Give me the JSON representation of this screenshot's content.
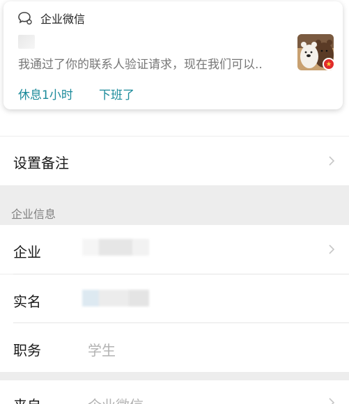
{
  "notification": {
    "app_name": "企业微信",
    "body": "我通过了你的联系人验证请求，现在我们可以..",
    "actions": [
      "休息1小时",
      "下班了"
    ]
  },
  "rows": {
    "remark": "设置备注",
    "section": "企业信息",
    "company": "企业",
    "realname": "实名",
    "position": "职务",
    "position_value": "学生",
    "source": "来自",
    "source_value": "企业微信"
  }
}
